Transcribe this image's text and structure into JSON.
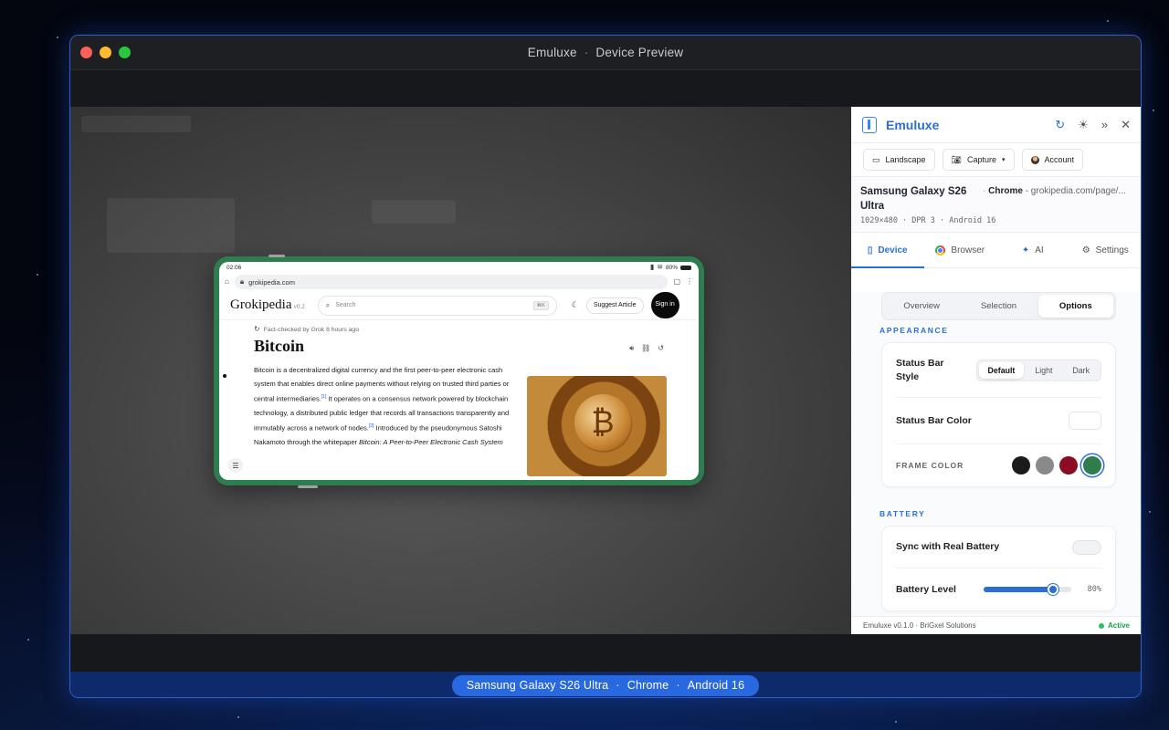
{
  "window": {
    "title_app": "Emuluxe",
    "title_sep": "·",
    "title_view": "Device Preview"
  },
  "colors": {
    "accent": "#2b6fd6",
    "frame_green": "#2e7d4f",
    "active_green": "#16a34a"
  },
  "phone": {
    "status_time": "02:06",
    "status_battery": "80%",
    "url": "grokipedia.com",
    "site": {
      "logo": "Grokipedia",
      "version": "v0.2",
      "search_placeholder": "Search",
      "search_kbd": "⌘K",
      "suggest_label": "Suggest Article",
      "signin_label": "Sign in"
    },
    "article": {
      "fact_check": "Fact-checked by Grok 8 hours ago",
      "title": "Bitcoin",
      "p1": "Bitcoin is a decentralized digital currency and the first peer-to-peer electronic cash system that enables direct online payments without relying on trusted third parties or central intermediaries.",
      "ref1": "[1]",
      "p2": " It operates on a consensus network powered by blockchain technology, a distributed public ledger that records all transactions transparently and immutably across a network of nodes.",
      "ref2": "[2]",
      "p3": " Introduced by the pseudonymous Satoshi Nakamoto through the whitepaper ",
      "p3_italic": "Bitcoin: A Peer-to-Peer Electronic Cash System"
    }
  },
  "panel": {
    "brand": "Emuluxe",
    "buttons": {
      "landscape": "Landscape",
      "capture": "Capture",
      "account": "Account"
    },
    "device": {
      "name": "Samsung Galaxy S26 Ultra",
      "browser": "Chrome",
      "url": "- grokipedia.com/page/...",
      "spec": "1029×480 · DPR 3 · Android 16"
    },
    "tabs": [
      {
        "label": "Device",
        "icon": "phone-icon"
      },
      {
        "label": "Browser",
        "icon": "chrome-icon"
      },
      {
        "label": "AI",
        "icon": "sparkle-icon"
      },
      {
        "label": "Settings",
        "icon": "gear-icon"
      }
    ],
    "subtabs": [
      "Overview",
      "Selection",
      "Options"
    ],
    "appearance": {
      "section": "APPEARANCE",
      "status_bar_style_label": "Status Bar Style",
      "status_bar_style_options": [
        "Default",
        "Light",
        "Dark"
      ],
      "status_bar_style_selected": "Default",
      "status_bar_color_label": "Status Bar Color",
      "frame_color_label": "FRAME COLOR",
      "frame_colors": [
        "#1b1b1b",
        "#8a8a8a",
        "#8b0d24",
        "#2e7d4f"
      ],
      "frame_color_selected": "#2e7d4f"
    },
    "battery": {
      "section": "BATTERY",
      "sync_label": "Sync with Real Battery",
      "sync_on": false,
      "level_label": "Battery Level",
      "level_value": 80,
      "level_text": "80%"
    },
    "footer": {
      "version": "Emuluxe v0.1.0 · BriGxel Solutions",
      "status": "Active"
    }
  },
  "statusbar": {
    "device": "Samsung Galaxy S26 Ultra",
    "browser": "Chrome",
    "os": "Android 16",
    "sep": "·"
  }
}
